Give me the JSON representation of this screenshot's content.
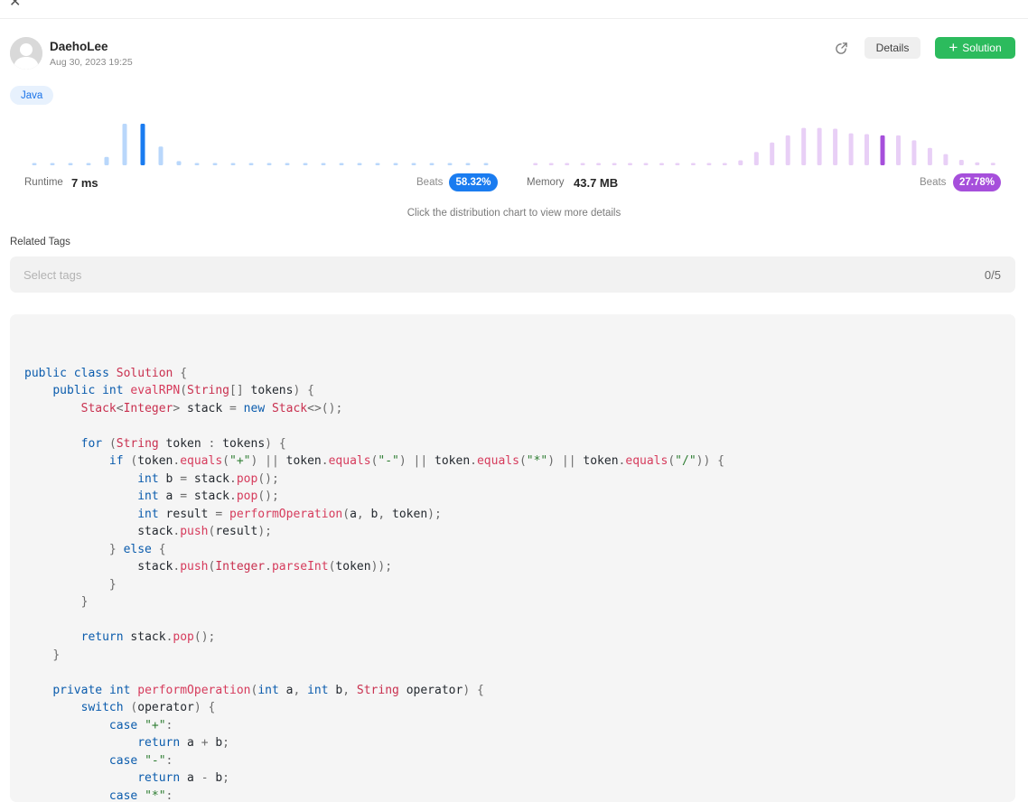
{
  "window": {
    "close_glyph": "✕"
  },
  "author": {
    "name": "DaehoLee",
    "timestamp": "Aug 30, 2023 19:25",
    "avatar_icon": "user-avatar-icon"
  },
  "actions": {
    "share_icon": "share-icon",
    "details_label": "Details",
    "solution_plus": "+",
    "solution_label": "Solution"
  },
  "language_tag": "Java",
  "runtime": {
    "label": "Runtime",
    "value": "7 ms",
    "beats_label": "Beats",
    "beats_value": "58.32%",
    "accent_color": "#1a7cf0",
    "light_color": "#b9d7fb",
    "distribution": [
      0,
      0,
      0,
      0,
      0.2,
      1,
      1,
      0.45,
      0.1,
      0,
      0,
      0,
      0,
      0,
      0,
      0,
      0,
      0,
      0,
      0,
      0,
      0,
      0,
      0,
      0,
      0
    ],
    "highlight_index": 6
  },
  "memory": {
    "label": "Memory",
    "value": "43.7 MB",
    "beats_label": "Beats",
    "beats_value": "27.78%",
    "accent_color": "#a64fdb",
    "light_color": "#e8cff6",
    "distribution": [
      0,
      0,
      0,
      0,
      0,
      0,
      0,
      0,
      0,
      0,
      0,
      0,
      0.02,
      0.12,
      0.32,
      0.55,
      0.72,
      0.9,
      0.9,
      0.88,
      0.77,
      0.75,
      0.72,
      0.72,
      0.6,
      0.42,
      0.27,
      0.13,
      0.07,
      0.06
    ],
    "highlight_index": 22
  },
  "chart_hint": "Click the distribution chart to view more details",
  "related_tags": {
    "title": "Related Tags",
    "placeholder": "Select tags",
    "count": "0/5"
  },
  "code": {
    "language": "Java",
    "lines": [
      "",
      "public class Solution {",
      "    public int evalRPN(String[] tokens) {",
      "        Stack<Integer> stack = new Stack<>();",
      "",
      "        for (String token : tokens) {",
      "            if (token.equals(\"+\") || token.equals(\"-\") || token.equals(\"*\") || token.equals(\"/\")) {",
      "                int b = stack.pop();",
      "                int a = stack.pop();",
      "                int result = performOperation(a, b, token);",
      "                stack.push(result);",
      "            } else {",
      "                stack.push(Integer.parseInt(token));",
      "            }",
      "        }",
      "",
      "        return stack.pop();",
      "    }",
      "",
      "    private int performOperation(int a, int b, String operator) {",
      "        switch (operator) {",
      "            case \"+\":",
      "                return a + b;",
      "            case \"-\":",
      "                return a - b;",
      "            case \"*\":"
    ]
  }
}
